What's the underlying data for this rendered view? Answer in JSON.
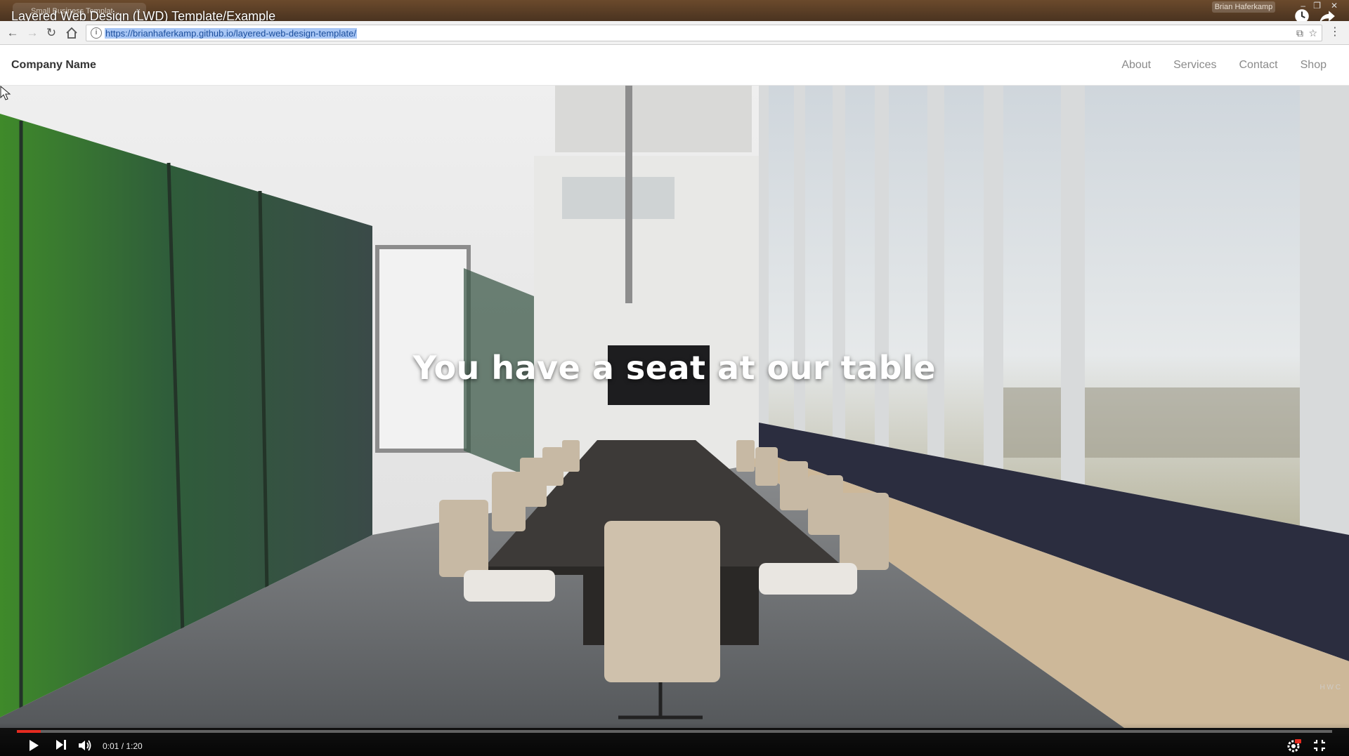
{
  "window": {
    "tab_title": "Small Business Templat...",
    "video_title": "Layered Web Design (LWD) Template/Example",
    "user_name": "Brian Haferkamp"
  },
  "browser": {
    "url": "https://brianhaferkamp.github.io/layered-web-design-template/"
  },
  "site": {
    "brand": "Company Name",
    "nav": [
      "About",
      "Services",
      "Contact",
      "Shop"
    ]
  },
  "hero": {
    "heading": "You have a seat at our table"
  },
  "player": {
    "time": "0:01 / 1:20",
    "progress_fraction": 0.018,
    "accent": "#e52b20"
  },
  "icons": [
    "back-icon",
    "forward-icon",
    "reload-icon",
    "home-icon",
    "info-icon",
    "star-icon",
    "menu-icon",
    "clock-icon",
    "share-icon",
    "play-icon",
    "next-icon",
    "volume-icon",
    "settings-icon",
    "fullscreen-exit-icon"
  ],
  "watermark": "H W C"
}
